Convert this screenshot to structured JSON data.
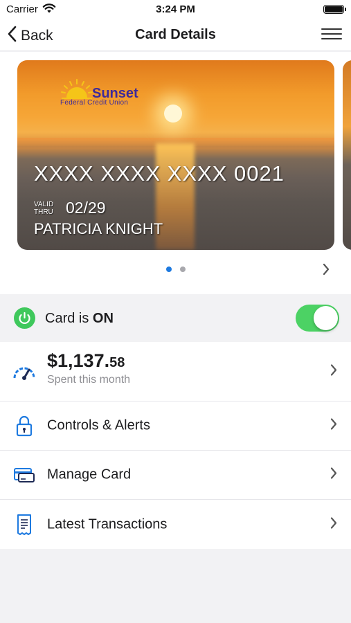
{
  "status_bar": {
    "carrier": "Carrier",
    "time": "3:24 PM"
  },
  "navbar": {
    "back_label": "Back",
    "title": "Card Details"
  },
  "card": {
    "issuer_name": "Sunset",
    "issuer_subtitle": "Federal Credit Union",
    "number": "XXXX XXXX XXXX 0021",
    "valid_line1": "VALID",
    "valid_line2": "THRU",
    "expiry": "02/29",
    "holder": "PATRICIA KNIGHT"
  },
  "carousel": {
    "page_count": 2,
    "active_page": 1
  },
  "card_status": {
    "prefix": "Card is ",
    "state": "ON",
    "enabled": true
  },
  "spending": {
    "amount_main": "$1,137.",
    "amount_cents": "58",
    "caption": "Spent this month"
  },
  "menu": [
    {
      "label": "Controls & Alerts",
      "icon": "lock-icon"
    },
    {
      "label": "Manage Card",
      "icon": "credit-card-icon"
    },
    {
      "label": "Latest Transactions",
      "icon": "receipt-icon"
    }
  ],
  "colors": {
    "accent": "#1e7ae0",
    "toggle_on": "#4cd264",
    "power_green": "#3fc85c",
    "brand": "#3d2a9a"
  }
}
